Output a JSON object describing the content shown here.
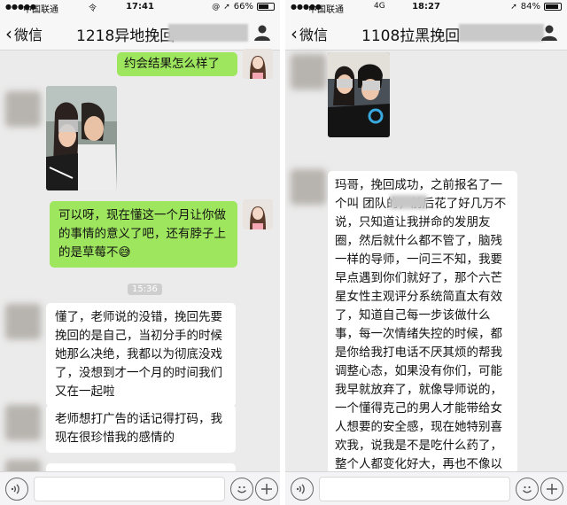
{
  "left_phone": {
    "status": {
      "carrier": "中国联通",
      "network": "令",
      "time": "17:41",
      "battery": "66%",
      "battery_level": 0.66
    },
    "nav": {
      "back_label": "微信",
      "title": "1218异地挽回"
    },
    "messages": {
      "sent_top": "约会结果怎么样了",
      "sent_green": "可以呀，现在懂这一个月让你做的事情的意义了吧，还有脖子上的是草莓不😅",
      "timestamp": "15:36",
      "received_1": "懂了，老师说的没错，挽回先要挽回的是自己，当初分手的时候她那么决绝，我都以为彻底没戏了，没想到才一个月的时间我们又在一起啦",
      "received_2": "老师想打广告的话记得打码，我现在很珍惜我的感情的"
    }
  },
  "right_phone": {
    "status": {
      "carrier": "中国联通",
      "network": "4G",
      "time": "18:27",
      "battery": "84%",
      "battery_level": 0.84
    },
    "nav": {
      "back_label": "微信",
      "title": "1108拉黑挽回"
    },
    "messages": {
      "received_long": "玛哥，挽回成功，之前报名了一个叫       团队的，前后花了好几万不说，只知道让我拼命的发朋友圈，然后就什么都不管了，脑残一样的导师，一问三不知，我要早点遇到你们就好了，那个六芒星女性主观评分系统简直太有效了，知道自己每一步该做什么事，每一次情绪失控的时候，都是你给我打电话不厌其烦的帮我调整心态，如果没有你们，可能我早就放弃了，就像导师说的，一个懂得克己的男人才能带给女人想要的安全感，现在她特别喜欢我，说我是不是吃什么药了，整个人都变化好大，再也不像以前一和我聊天就无语了，我也能感觉到自己彻底改变了，由内而外的，再也不怕失去她了，良心"
    }
  },
  "colors": {
    "green_bubble": "#9fe65f",
    "chat_bg": "#ebebeb",
    "nav_bg": "#f7f7f7"
  }
}
